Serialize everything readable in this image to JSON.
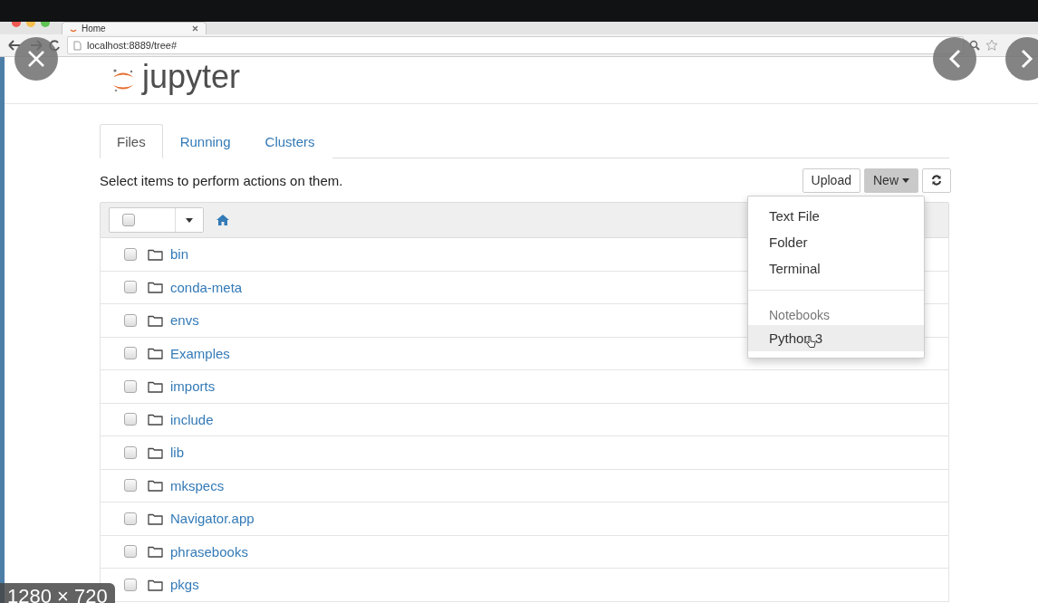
{
  "viewer": {
    "size_label": "1280 × 720"
  },
  "browser": {
    "tab_title": "Home",
    "url": "localhost:8889/tree#"
  },
  "header": {
    "logo": "jupyter"
  },
  "tabs": [
    {
      "label": "Files",
      "selected": true
    },
    {
      "label": "Running",
      "selected": false
    },
    {
      "label": "Clusters",
      "selected": false
    }
  ],
  "hint": "Select items to perform actions on them.",
  "toolbar": {
    "upload": "Upload",
    "new": "New"
  },
  "new_menu": {
    "open": true,
    "items": [
      {
        "kind": "item",
        "label": "Text File",
        "selected": false
      },
      {
        "kind": "item",
        "label": "Folder",
        "selected": false
      },
      {
        "kind": "item",
        "label": "Terminal",
        "selected": false
      },
      {
        "kind": "divider"
      },
      {
        "kind": "header",
        "label": "Notebooks"
      },
      {
        "kind": "item",
        "label": "Python 3",
        "selected": true
      }
    ]
  },
  "list_header": {
    "checked": false
  },
  "rows": [
    {
      "name": "bin",
      "checked": false
    },
    {
      "name": "conda-meta",
      "checked": false
    },
    {
      "name": "envs",
      "checked": false
    },
    {
      "name": "Examples",
      "checked": false
    },
    {
      "name": "imports",
      "checked": false
    },
    {
      "name": "include",
      "checked": false
    },
    {
      "name": "lib",
      "checked": false
    },
    {
      "name": "mkspecs",
      "checked": false
    },
    {
      "name": "Navigator.app",
      "checked": false
    },
    {
      "name": "phrasebooks",
      "checked": false
    },
    {
      "name": "pkgs",
      "checked": false
    }
  ]
}
